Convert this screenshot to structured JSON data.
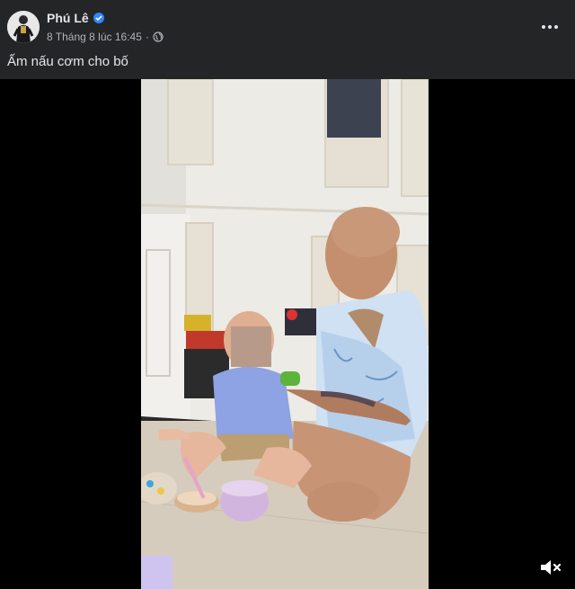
{
  "post": {
    "author": "Phú Lê",
    "timestamp": "8 Tháng 8 lúc 16:45",
    "separator": "·",
    "caption": "Ấm nấu cơm cho bố"
  },
  "icons": {
    "verified": "verified-badge-icon",
    "privacy": "globe-icon",
    "more": "more-options-icon",
    "mute": "volume-muted-icon"
  },
  "colors": {
    "background": "#242526",
    "verified": "#2d88ff",
    "text": "#e4e6eb",
    "secondary": "#b0b3b8"
  }
}
